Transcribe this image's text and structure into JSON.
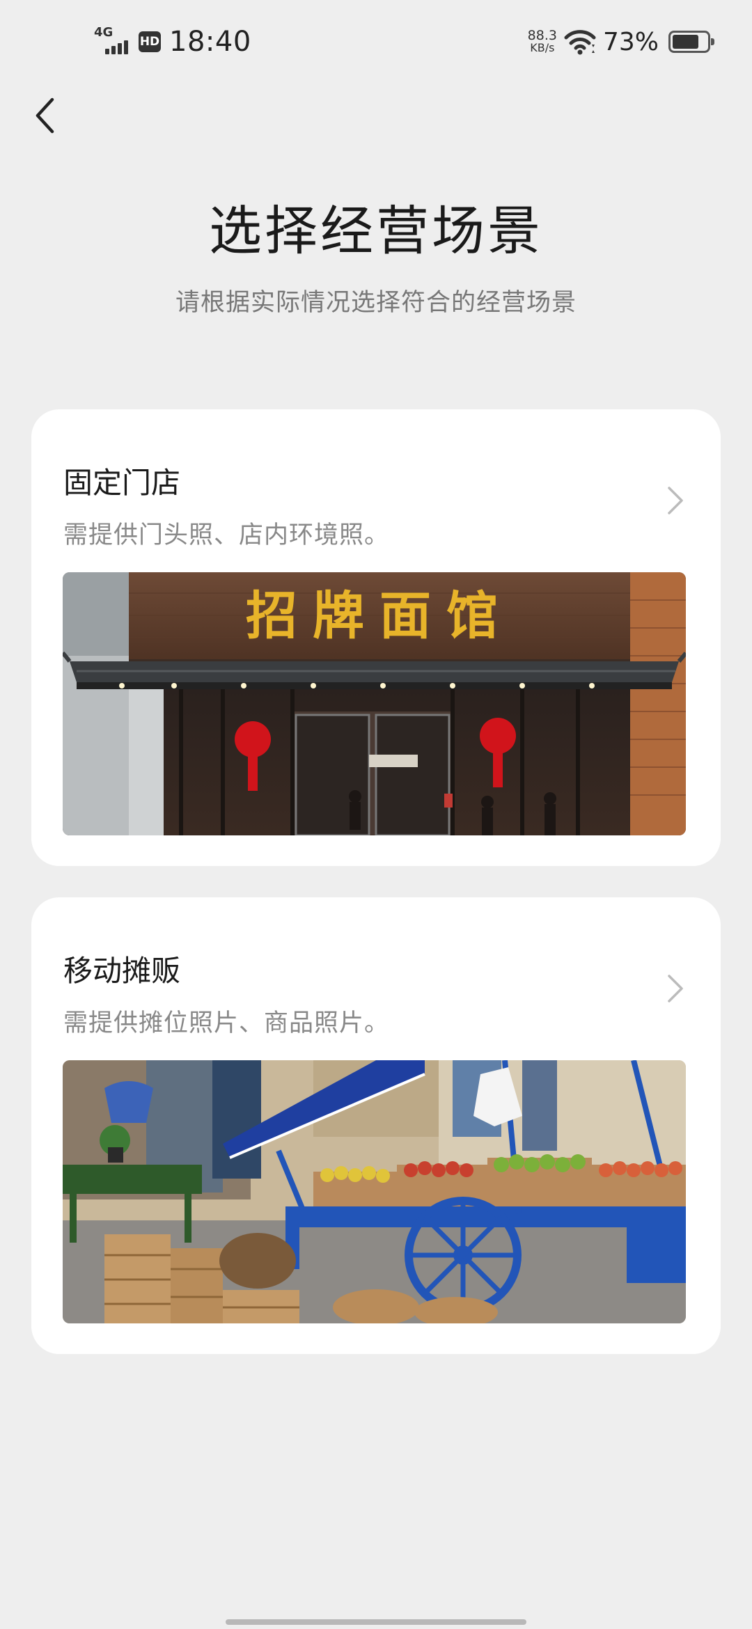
{
  "status_bar": {
    "network": "4G",
    "hd": "HD",
    "time": "18:40",
    "speed_value": "88.3",
    "speed_unit": "KB/s",
    "battery_percent": "73%",
    "battery_level": 0.73
  },
  "header": {
    "back_icon": "chevron-left-icon",
    "title": "选择经营场景",
    "subtitle": "请根据实际情况选择符合的经营场景"
  },
  "options": [
    {
      "title": "固定门店",
      "description": "需提供门头照、店内环境照。",
      "image_sign_text": "招牌面馆"
    },
    {
      "title": "移动摊贩",
      "description": "需提供摊位照片、商品照片。"
    }
  ],
  "colors": {
    "background": "#eeeeee",
    "card": "#ffffff",
    "title": "#1a1a1a",
    "subtitle": "#777777",
    "chevron": "#bbbbbb",
    "sign_gold": "#e8b42a",
    "cart_blue": "#2255b8"
  }
}
